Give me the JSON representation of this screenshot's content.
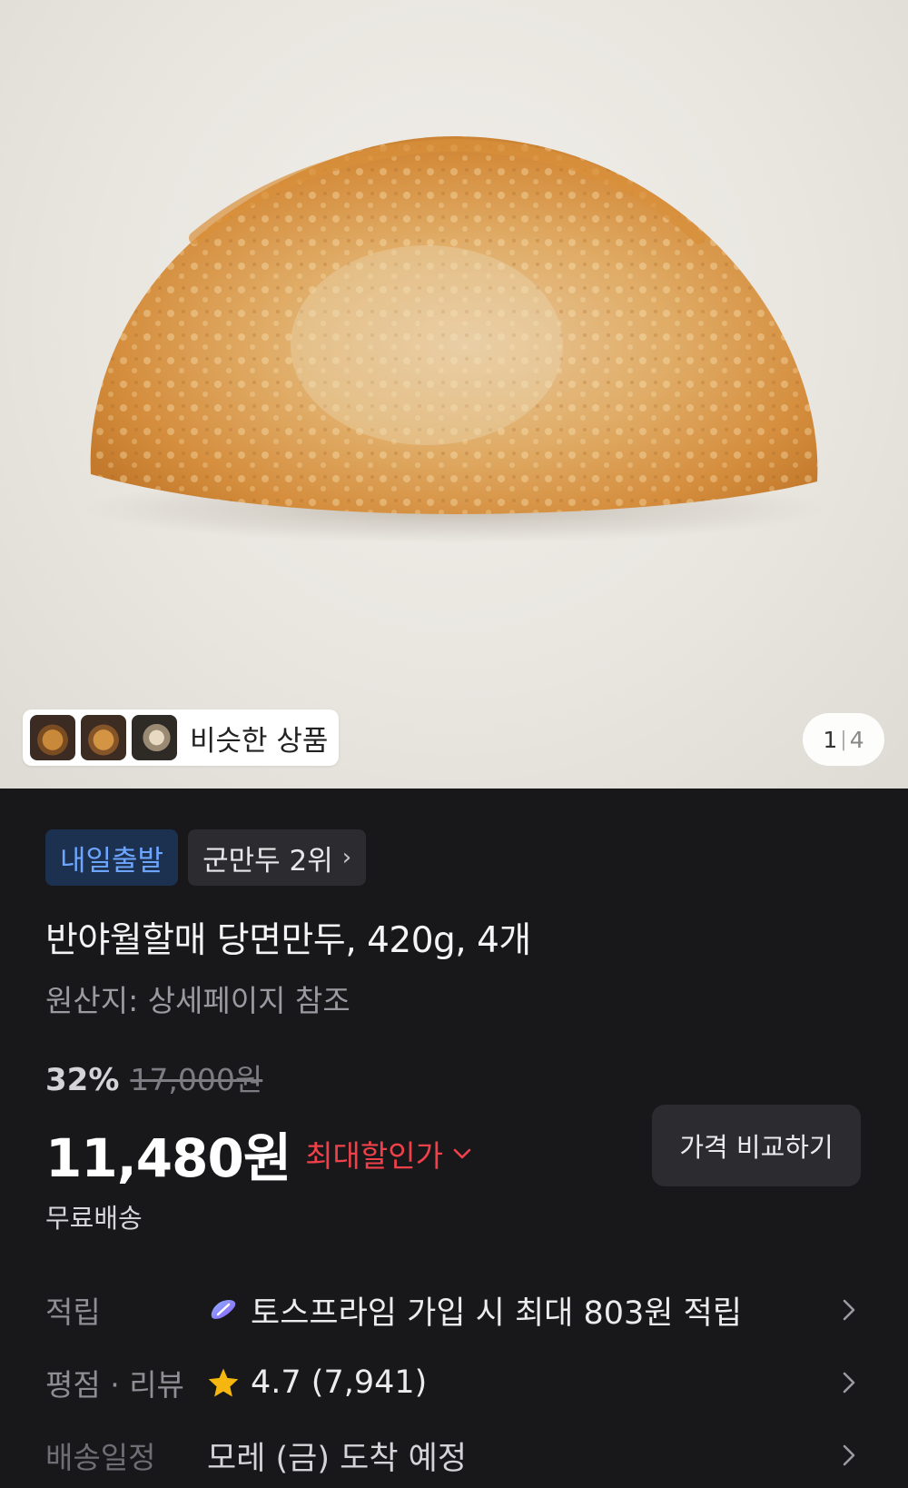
{
  "similar": {
    "label": "비슷한 상품"
  },
  "pager": {
    "current": "1",
    "separator": "|",
    "total": "4"
  },
  "badges": {
    "delivery": "내일출발",
    "rank": "군만두 2위",
    "rank_chevron": "›"
  },
  "product": {
    "title": "반야월할매 당면만두, 420g, 4개",
    "origin": "원산지: 상세페이지 참조"
  },
  "pricing": {
    "discount_rate": "32%",
    "original_price": "17,000원",
    "price": "11,480원",
    "max_discount_label": "최대할인가",
    "compare_button": "가격 비교하기",
    "shipping": "무료배송"
  },
  "rows": {
    "points": {
      "label": "적립",
      "value": "토스프라임 가입 시 최대 803원 적립",
      "icon": "toss-prime-icon"
    },
    "rating": {
      "label": "평점 · 리뷰",
      "value": "4.7 (7,941)",
      "icon": "star-icon"
    },
    "delivery": {
      "label": "배송일정",
      "value": "모레 (금) 도착 예정"
    }
  },
  "colors": {
    "background": "#18181b",
    "delivery_badge_bg": "#1c3150",
    "delivery_badge_text": "#6ea6ff",
    "discount_red": "#f0414a",
    "star": "#f5b70f"
  }
}
